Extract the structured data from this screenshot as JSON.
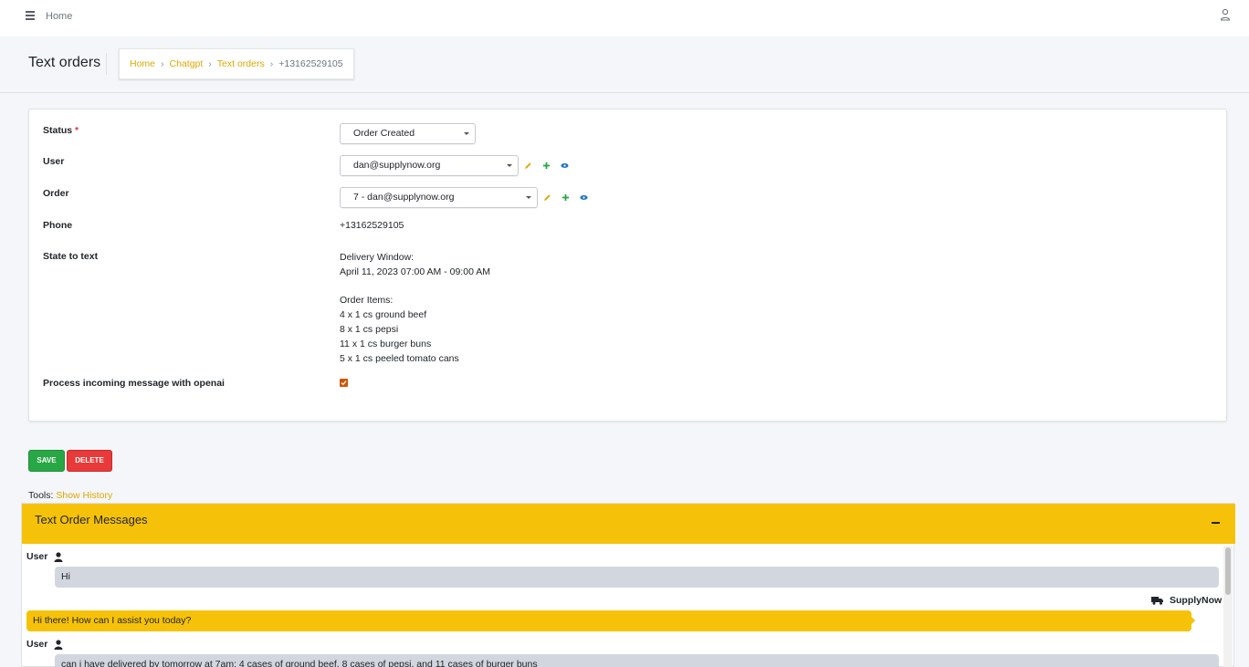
{
  "topbar": {
    "home_label": "Home"
  },
  "page": {
    "title": "Text orders"
  },
  "breadcrumb": [
    {
      "label": "Home"
    },
    {
      "label": "Chatgpt"
    },
    {
      "label": "Text orders"
    },
    {
      "label": "+13162529105"
    }
  ],
  "form": {
    "status": {
      "label": "Status",
      "required_mark": "*",
      "value": "Order Created"
    },
    "user": {
      "label": "User",
      "value": "dan@supplynow.org"
    },
    "order": {
      "label": "Order",
      "value": "7 - dan@supplynow.org"
    },
    "phone": {
      "label": "Phone",
      "value": "+13162529105"
    },
    "state_to_text": {
      "label": "State to text",
      "value": "Delivery Window:\nApril 11, 2023 07:00 AM - 09:00 AM\n\nOrder Items:\n4 x 1 cs ground beef\n8 x 1 cs pepsi\n11 x 1 cs burger buns\n5 x 1 cs peeled tomato cans"
    },
    "process_openai": {
      "label": "Process incoming message with openai",
      "checked": true
    }
  },
  "buttons": {
    "save": "SAVE",
    "delete": "DELETE"
  },
  "tools": {
    "prefix": "Tools:",
    "link": "Show History"
  },
  "messages_panel": {
    "title": "Text Order Messages",
    "messages": [
      {
        "sender": "User",
        "text": "Hi"
      },
      {
        "sender": "SupplyNow",
        "text": "Hi there! How can I assist you today?"
      },
      {
        "sender": "User",
        "text": "can i have delivered by tomorrow at 7am: 4 cases of ground beef, 8 cases of pepsi, and 11 cases of burger buns"
      }
    ]
  },
  "colors": {
    "accent": "#f6c209",
    "link": "#e0a800",
    "save": "#28a745",
    "delete": "#e83a3a",
    "user_bubble": "#d2d6de"
  }
}
